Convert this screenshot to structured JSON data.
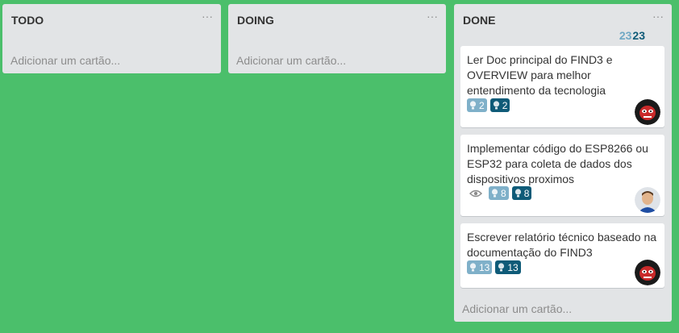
{
  "lists": [
    {
      "title": "TODO",
      "menu": "···",
      "add_card": "Adicionar um cartão..."
    },
    {
      "title": "DOING",
      "menu": "···",
      "add_card": "Adicionar um cartão..."
    },
    {
      "title": "DONE",
      "menu": "···",
      "add_card": "Adicionar um cartão...",
      "counts": {
        "a": "23",
        "b": "23"
      },
      "cards": [
        {
          "title": "Ler Doc principal do FIND3 e OVERVIEW para melhor entendimento da tecnologia",
          "badge_light": "2",
          "badge_dark": "2",
          "avatar": "avatar-red-mask"
        },
        {
          "title": "Implementar código do ESP8266 ou ESP32 para coleta de dados dos dispositivos proximos",
          "watch_icon": "eye-icon",
          "badge_light": "8",
          "badge_dark": "8",
          "avatar": "avatar-person"
        },
        {
          "title": "Escrever relatório técnico baseado na documentação do FIND3",
          "badge_light": "13",
          "badge_dark": "13",
          "avatar": "avatar-red-mask"
        }
      ]
    }
  ],
  "colors": {
    "board_bg": "#4bbf6b",
    "list_bg": "#e2e4e6",
    "badge_light": "#7fb0c9",
    "badge_dark": "#0f5b78"
  }
}
